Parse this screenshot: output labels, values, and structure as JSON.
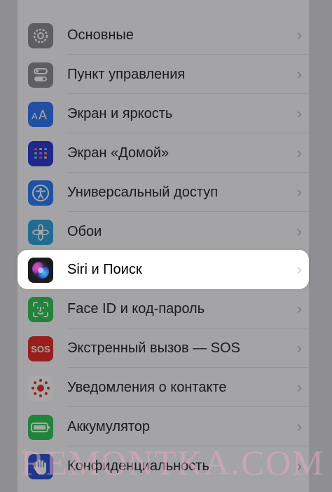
{
  "settings": {
    "items": [
      {
        "label": "Основные",
        "icon": "gear-icon",
        "color": "#8e8e93"
      },
      {
        "label": "Пункт управления",
        "icon": "control-center-icon",
        "color": "#8e8e93"
      },
      {
        "label": "Экран и яркость",
        "icon": "text-size-icon",
        "color": "#3478f6"
      },
      {
        "label": "Экран «Домой»",
        "icon": "home-grid-icon",
        "color": "#2f3bd1"
      },
      {
        "label": "Универсальный доступ",
        "icon": "accessibility-icon",
        "color": "#2d7cf6"
      },
      {
        "label": "Обои",
        "icon": "flower-icon",
        "color": "#33a3dc"
      },
      {
        "label": "Siri и Поиск",
        "icon": "siri-icon",
        "color": "#1c1c1e"
      },
      {
        "label": "Face ID и код-пароль",
        "icon": "face-id-icon",
        "color": "#34c759"
      },
      {
        "label": "Экстренный вызов — SOS",
        "icon": "sos-icon",
        "color": "#e5302a",
        "icon_text": "SOS"
      },
      {
        "label": "Уведомления о контакте",
        "icon": "exposure-icon",
        "color": "#ffffff"
      },
      {
        "label": "Аккумулятор",
        "icon": "battery-icon",
        "color": "#34c759"
      },
      {
        "label": "Конфиденциальность",
        "icon": "privacy-hand-icon",
        "color": "#2d55d6"
      }
    ],
    "chevron": "›",
    "highlighted_index": 6
  },
  "watermark": "REMONTKA.COM"
}
